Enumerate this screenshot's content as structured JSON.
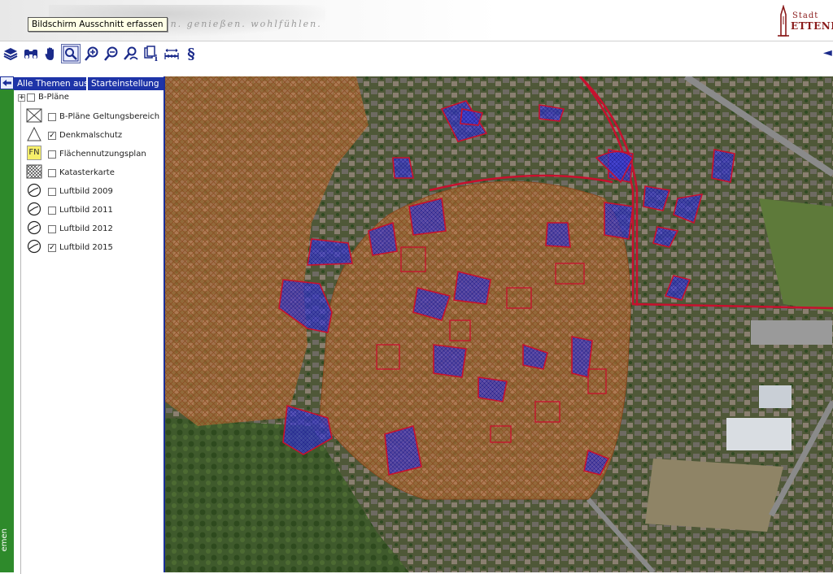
{
  "header": {
    "tooltip": "Bildschirm Ausschnitt erfassen",
    "slogan": "leben. genießen. wohlfühlen.",
    "logo_small": "Stadt",
    "logo_name": "ETTENHEIM"
  },
  "toolbar": {
    "tools": [
      {
        "name": "layers-icon"
      },
      {
        "name": "binoculars-icon"
      },
      {
        "name": "pan-hand-icon"
      },
      {
        "name": "zoom-box-icon",
        "active": true
      },
      {
        "name": "zoom-in-icon"
      },
      {
        "name": "zoom-out-icon"
      },
      {
        "name": "user-zoom-icon"
      },
      {
        "name": "info-icon"
      },
      {
        "name": "measure-icon"
      },
      {
        "name": "paragraph-icon"
      }
    ],
    "paragraph_label": "§"
  },
  "panel": {
    "btn_all_off": "Alle Themen aus",
    "btn_start": "Starteinstellung",
    "root_label": "B-Pläne",
    "strip_label": "emen",
    "layers": [
      {
        "label": "B-Pläne Geltungsbereich",
        "checked": false,
        "legend": "cross-box"
      },
      {
        "label": "Denkmalschutz",
        "checked": true,
        "legend": "monument"
      },
      {
        "label": "Flächennutzungsplan",
        "checked": false,
        "legend": "fn"
      },
      {
        "label": "Katasterkarte",
        "checked": false,
        "legend": "hatch"
      },
      {
        "label": "Luftbild 2009",
        "checked": false,
        "legend": "circle"
      },
      {
        "label": "Luftbild 2011",
        "checked": false,
        "legend": "circle"
      },
      {
        "label": "Luftbild 2012",
        "checked": false,
        "legend": "circle"
      },
      {
        "label": "Luftbild 2015",
        "checked": true,
        "legend": "circle"
      }
    ],
    "fn_text": "FN"
  },
  "colors": {
    "panel_blue": "#1e34a8",
    "strip_green": "#2e8a2b",
    "boundary_red": "#c8102e",
    "monument_fill": "#3a3ad0",
    "hatch_orange": "#c9793a"
  }
}
